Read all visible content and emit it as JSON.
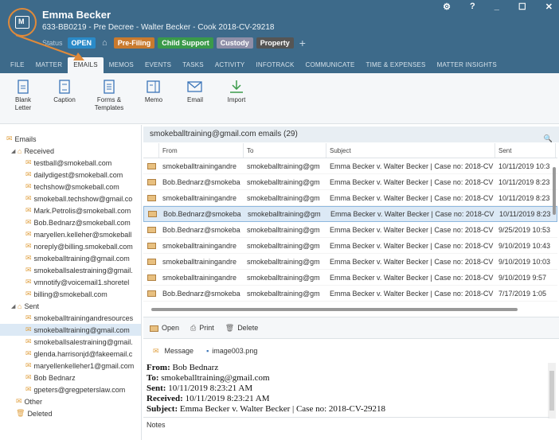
{
  "header": {
    "client_name": "Emma Becker",
    "matter_line": "633-BB0219 - Pre Decree - Walter Becker - Cook 2018-CV-29218",
    "status_label": "Status",
    "status_value": "OPEN",
    "tags": [
      {
        "label": "Pre-Filing",
        "color": "#c97a2e"
      },
      {
        "label": "Child Support",
        "color": "#3a9a4a"
      },
      {
        "label": "Custody",
        "color": "#8f8fa8"
      },
      {
        "label": "Property",
        "color": "#555555"
      }
    ],
    "window_controls": [
      "⚙",
      "?",
      "_",
      "☐",
      "✕"
    ]
  },
  "tabs": [
    "FILE",
    "MATTER",
    "EMAILS",
    "MEMOS",
    "EVENTS",
    "TASKS",
    "ACTIVITY",
    "INFOTRACK",
    "COMMUNICATE",
    "TIME & EXPENSES",
    "MATTER INSIGHTS"
  ],
  "ribbon": {
    "blank_letter": "Blank Letter",
    "caption": "Caption",
    "forms_templates": "Forms & Templates",
    "memo": "Memo",
    "email": "Email",
    "import": "Import"
  },
  "tree": {
    "root": "Emails",
    "received": "Received",
    "received_items": [
      "testball@smokeball.com",
      "dailydigest@smokeball.com",
      "techshow@smokeball.com",
      "smokeball.techshow@gmail.co",
      "Mark.Petrolis@smokeball.com",
      "Bob.Bednarz@smokeball.com",
      "maryellen.kelleher@smokeball",
      "noreply@billing.smokeball.com",
      "smokeballtraining@gmail.com",
      "smokeballsalestraining@gmail.",
      "vmnotify@voicemail1.shoretel",
      "billing@smokeball.com"
    ],
    "sent": "Sent",
    "sent_items": [
      "smokeballtrainingandresources",
      "smokeballtraining@gmail.com",
      "smokeballsalestraining@gmail.",
      "glenda.harrisonjd@fakeemail.c",
      "maryellenkelleher1@gmail.com",
      "Bob Bednarz",
      "gpeters@gregpeterslaw.com"
    ],
    "other": "Other",
    "deleted": "Deleted"
  },
  "list": {
    "header": "smokeballtraining@gmail.com emails (29)",
    "columns": [
      "From",
      "To",
      "Subject",
      "Sent"
    ],
    "rows": [
      {
        "from": "smokeballtrainingandre",
        "to": "smokeballtraining@gm",
        "subject": "Emma Becker v. Walter Becker | Case no: 2018-CV",
        "sent": "10/11/2019 10:3"
      },
      {
        "from": "Bob.Bednarz@smokeba",
        "to": "smokeballtraining@gm",
        "subject": "Emma Becker v. Walter Becker | Case no: 2018-CV",
        "sent": "10/11/2019 8:23"
      },
      {
        "from": "smokeballtrainingandre",
        "to": "smokeballtraining@gm",
        "subject": "Emma Becker v. Walter Becker | Case no: 2018-CV",
        "sent": "10/11/2019 8:23"
      },
      {
        "from": "Bob.Bednarz@smokeba",
        "to": "smokeballtraining@gm",
        "subject": "Emma Becker v. Walter Becker | Case no: 2018-CV",
        "sent": "10/11/2019 8:23"
      },
      {
        "from": "Bob.Bednarz@smokeba",
        "to": "smokeballtraining@gm",
        "subject": "Emma Becker v. Walter Becker | Case no: 2018-CV",
        "sent": "9/25/2019 10:53"
      },
      {
        "from": "smokeballtrainingandre",
        "to": "smokeballtraining@gm",
        "subject": "Emma Becker v. Walter Becker | Case no: 2018-CV",
        "sent": "9/10/2019 10:43"
      },
      {
        "from": "smokeballtrainingandre",
        "to": "smokeballtraining@gm",
        "subject": "Emma Becker v. Walter Becker | Case no: 2018-CV",
        "sent": "9/10/2019 10:03"
      },
      {
        "from": "smokeballtrainingandre",
        "to": "smokeballtraining@gm",
        "subject": "Emma Becker v. Walter Becker | Case no: 2018-CV",
        "sent": "9/10/2019 9:57"
      },
      {
        "from": "Bob.Bednarz@smokeba",
        "to": "smokeballtraining@gm",
        "subject": "Emma Becker v. Walter Becker | Case no: 2018-CV",
        "sent": "7/17/2019 1:05"
      }
    ]
  },
  "actions": {
    "open": "Open",
    "print": "Print",
    "delete": "Delete"
  },
  "attachments": {
    "message": "Message",
    "image": "image003.png"
  },
  "preview": {
    "from_label": "From:",
    "from_value": "Bob Bednarz",
    "to_label": "To:",
    "to_value": "smokeballtraining@gmail.com",
    "sent_label": "Sent:",
    "sent_value": "10/11/2019 8:23:21 AM",
    "received_label": "Received:",
    "received_value": "10/11/2019 8:23:21 AM",
    "subject_label": "Subject:",
    "subject_value": "Emma Becker v. Walter Becker | Case no: 2018-CV-29218"
  },
  "notes_label": "Notes"
}
